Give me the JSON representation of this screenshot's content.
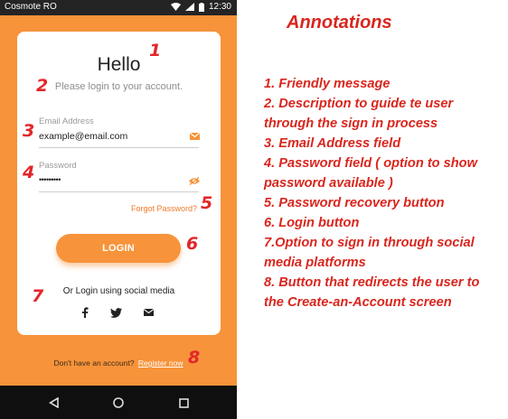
{
  "status_bar": {
    "carrier": "Cosmote RO",
    "time": "12:30"
  },
  "login_card": {
    "greeting": "Hello",
    "description": "Please login to your account.",
    "email": {
      "label": "Email Address",
      "value": "example@email.com"
    },
    "password": {
      "label": "Password",
      "value": "•••••••••"
    },
    "forgot_password": "Forgot Password?",
    "login_button": "LOGIN",
    "social_text": "Or Login using social media",
    "social_icons": [
      "facebook-icon",
      "twitter-icon",
      "email-icon"
    ]
  },
  "register": {
    "prompt": "Don't have an account?",
    "link": "Register now"
  },
  "markers": [
    "1",
    "2",
    "3",
    "4",
    "5",
    "6",
    "7",
    "8"
  ],
  "annotations": {
    "title": "Annotations",
    "items": [
      "1. Friendly message",
      "2. Description to guide te user through the sign in process",
      "3. Email Address field",
      "4. Password field ( option to show password available )",
      "5. Password recovery button",
      "6. Login button",
      "7.Option to sign in through social media platforms",
      "8. Button that redirects the user to the Create-an-Account screen"
    ]
  },
  "colors": {
    "brand_orange": "#f7933a",
    "annotation_red": "#d9261e",
    "status_bar": "#242424"
  }
}
